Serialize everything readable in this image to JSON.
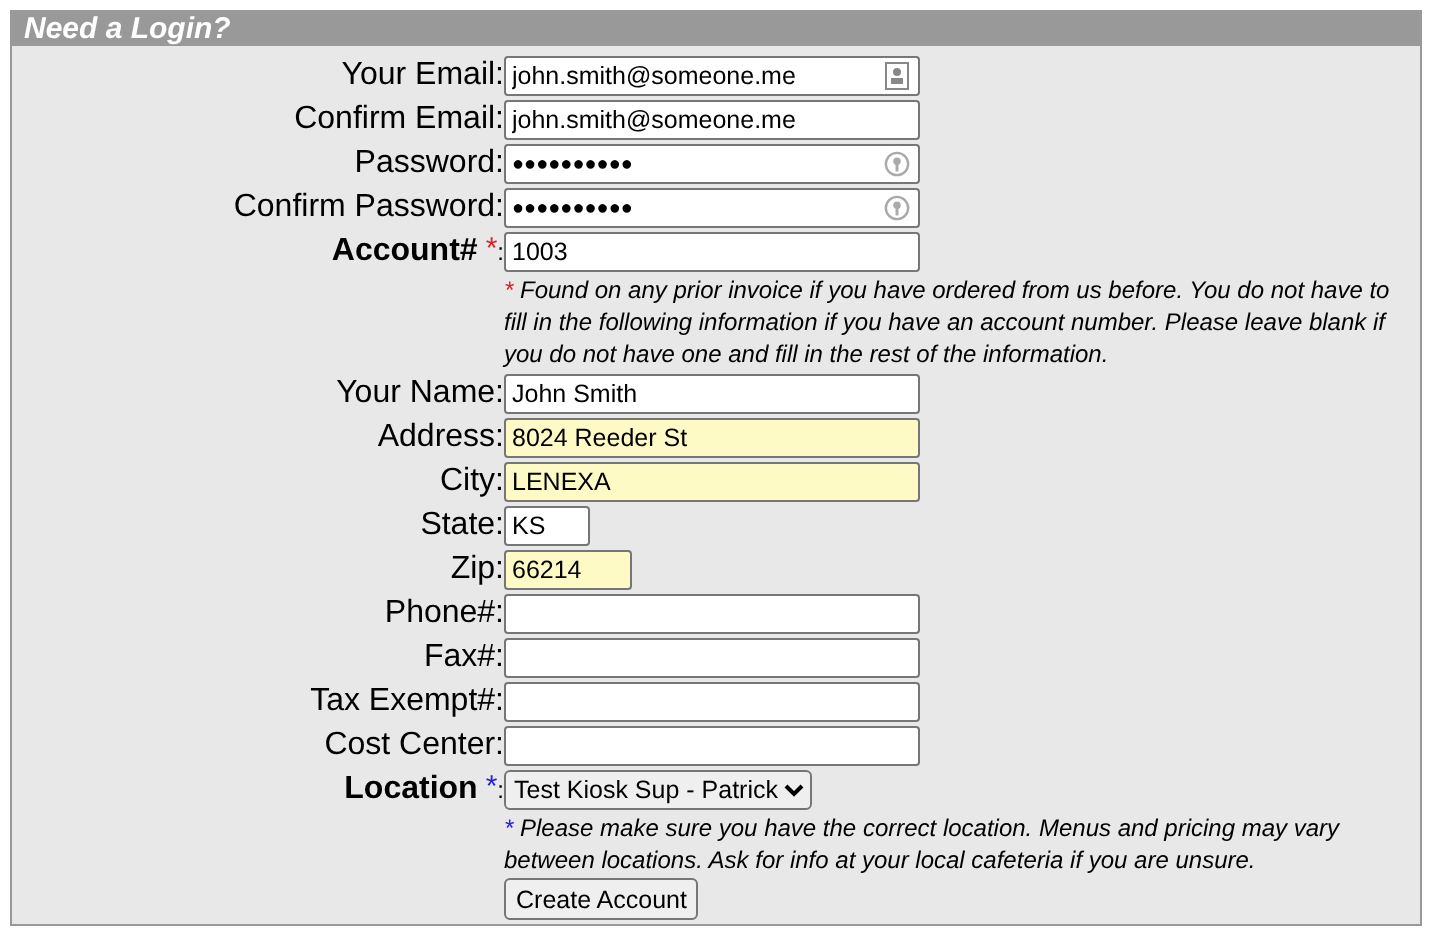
{
  "panel": {
    "title": "Need a Login?"
  },
  "fields": [
    {
      "label": "Your Email:",
      "kind": "email",
      "value": "john.smith@someone.me",
      "bold": false,
      "autofilled": false
    },
    {
      "label": "Confirm Email:",
      "kind": "text",
      "value": "john.smith@someone.me",
      "bold": false,
      "autofilled": false
    },
    {
      "label": "Password:",
      "kind": "password",
      "value": "●●●●●●●●●●",
      "bold": false,
      "autofilled": false
    },
    {
      "label": "Confirm Password:",
      "kind": "password",
      "value": "●●●●●●●●●●",
      "bold": false,
      "autofilled": false
    },
    {
      "label": "Account#",
      "kind": "text",
      "value": "1003",
      "bold": true,
      "autofilled": false,
      "required": {
        "mark": "*",
        "color": "#e02020",
        "suffix": ":"
      },
      "note": {
        "mark": "*",
        "text": "Found on any prior invoice if you have ordered from us before. You do not have to fill in the following information if you have an account number. Please leave blank if you do not have one and fill in the rest of the information."
      }
    },
    {
      "label": "Your Name:",
      "kind": "text",
      "value": "John Smith",
      "bold": false,
      "autofilled": false
    },
    {
      "label": "Address:",
      "kind": "text",
      "value": "8024 Reeder St",
      "bold": false,
      "autofilled": true
    },
    {
      "label": "City:",
      "kind": "text",
      "value": "LENEXA",
      "bold": false,
      "autofilled": true
    },
    {
      "label": "State:",
      "kind": "short",
      "value": "KS",
      "bold": false,
      "autofilled": false
    },
    {
      "label": "Zip:",
      "kind": "short",
      "value": "66214",
      "bold": false,
      "autofilled": true
    },
    {
      "label": "Phone#:",
      "kind": "text",
      "bold": false,
      "autofilled": false
    },
    {
      "label": "Fax#:",
      "kind": "text",
      "bold": false,
      "autofilled": false
    },
    {
      "label": "Tax Exempt#:",
      "kind": "text",
      "bold": false,
      "autofilled": false
    },
    {
      "label": "Cost Center:",
      "kind": "text",
      "bold": false,
      "autofilled": false
    },
    {
      "label": "Location",
      "kind": "select",
      "value": "Test Kiosk Sup - Patrick",
      "bold": true,
      "required": {
        "mark": "*",
        "color": "#2020e0",
        "suffix": ":"
      },
      "note": {
        "mark": "*",
        "text": "Please make sure you have the correct location. Menus and pricing may vary between locations. Ask for info at your local cafeteria if you are unsure."
      }
    }
  ],
  "submit": {
    "label": "Create Account"
  }
}
